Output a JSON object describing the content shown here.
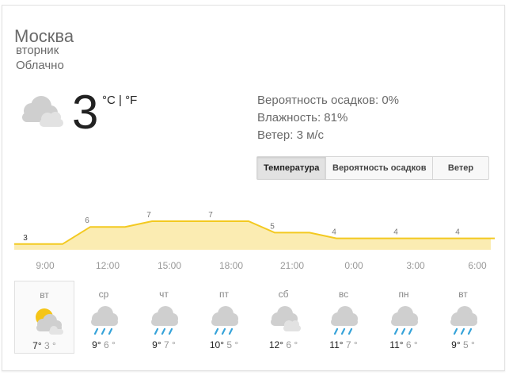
{
  "location": "Москва",
  "day": "вторник",
  "condition": "Облачно",
  "current": {
    "temp": "3",
    "unit_c": "°C",
    "unit_sep": "|",
    "unit_f": "°F",
    "icon": "cloudy-icon"
  },
  "details": {
    "precip": "Вероятность осадков: 0%",
    "humidity": "Влажность: 81%",
    "wind": "Ветер: 3 м/с"
  },
  "tabs": [
    "Температура",
    "Вероятность осадков",
    "Ветер"
  ],
  "active_tab": 0,
  "chart_data": {
    "type": "area",
    "x": [
      "9:00",
      "12:00",
      "15:00",
      "18:00",
      "21:00",
      "0:00",
      "3:00",
      "6:00"
    ],
    "values": [
      3,
      6,
      7,
      7,
      5,
      4,
      4,
      4
    ],
    "fill_color": "#fbecb2",
    "line_color": "#f3c920"
  },
  "colors": {
    "sun": "#f5c518",
    "cloud": "#d8d8d8",
    "rain": "#36a3d9"
  },
  "forecast": [
    {
      "day": "вт",
      "hi": "7",
      "lo": "3",
      "icon": "partly-cloudy-icon"
    },
    {
      "day": "ср",
      "hi": "9",
      "lo": "6",
      "icon": "rain-cloud-icon"
    },
    {
      "day": "чт",
      "hi": "9",
      "lo": "7",
      "icon": "rain-cloud-icon"
    },
    {
      "day": "пт",
      "hi": "10",
      "lo": "5",
      "icon": "rain-cloud-icon"
    },
    {
      "day": "сб",
      "hi": "12",
      "lo": "6",
      "icon": "cloudy-icon"
    },
    {
      "day": "вс",
      "hi": "11",
      "lo": "7",
      "icon": "rain-cloud-icon"
    },
    {
      "day": "пн",
      "hi": "11",
      "lo": "6",
      "icon": "rain-cloud-icon"
    },
    {
      "day": "вт",
      "hi": "9",
      "lo": "5",
      "icon": "rain-cloud-icon"
    }
  ]
}
